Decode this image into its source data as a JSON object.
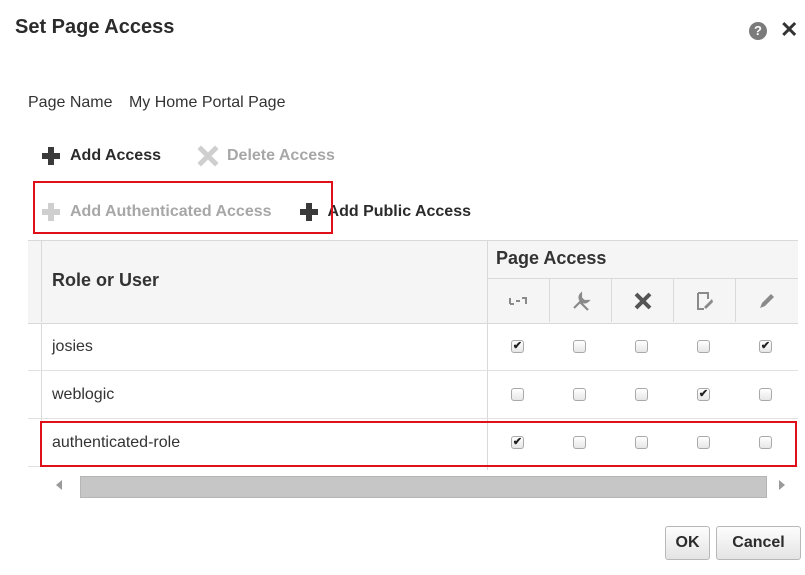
{
  "dialog": {
    "title": "Set Page Access",
    "help_icon": "help-icon",
    "close_icon": "close-icon",
    "help_glyph": "?",
    "close_glyph": "✕"
  },
  "page_name": {
    "label": "Page Name",
    "value": "My Home Portal Page"
  },
  "toolbar": {
    "add_access": "Add Access",
    "delete_access": "Delete Access",
    "add_authenticated_access": "Add Authenticated Access",
    "add_public_access": "Add Public Access"
  },
  "table": {
    "role_header": "Role or User",
    "page_access_header": "Page Access",
    "permission_icons": [
      "view-icon",
      "customize-icon",
      "delete-icon",
      "update-icon",
      "edit-icon"
    ],
    "rows": [
      {
        "name": "josies",
        "perms": [
          true,
          false,
          false,
          false,
          true
        ]
      },
      {
        "name": "weblogic",
        "perms": [
          false,
          false,
          false,
          true,
          false
        ]
      },
      {
        "name": "authenticated-role",
        "perms": [
          true,
          false,
          false,
          false,
          false
        ]
      }
    ]
  },
  "buttons": {
    "ok": "OK",
    "cancel": "Cancel"
  },
  "colors": {
    "highlight": "#e0101a",
    "disabled_text": "#a7a7a7"
  }
}
